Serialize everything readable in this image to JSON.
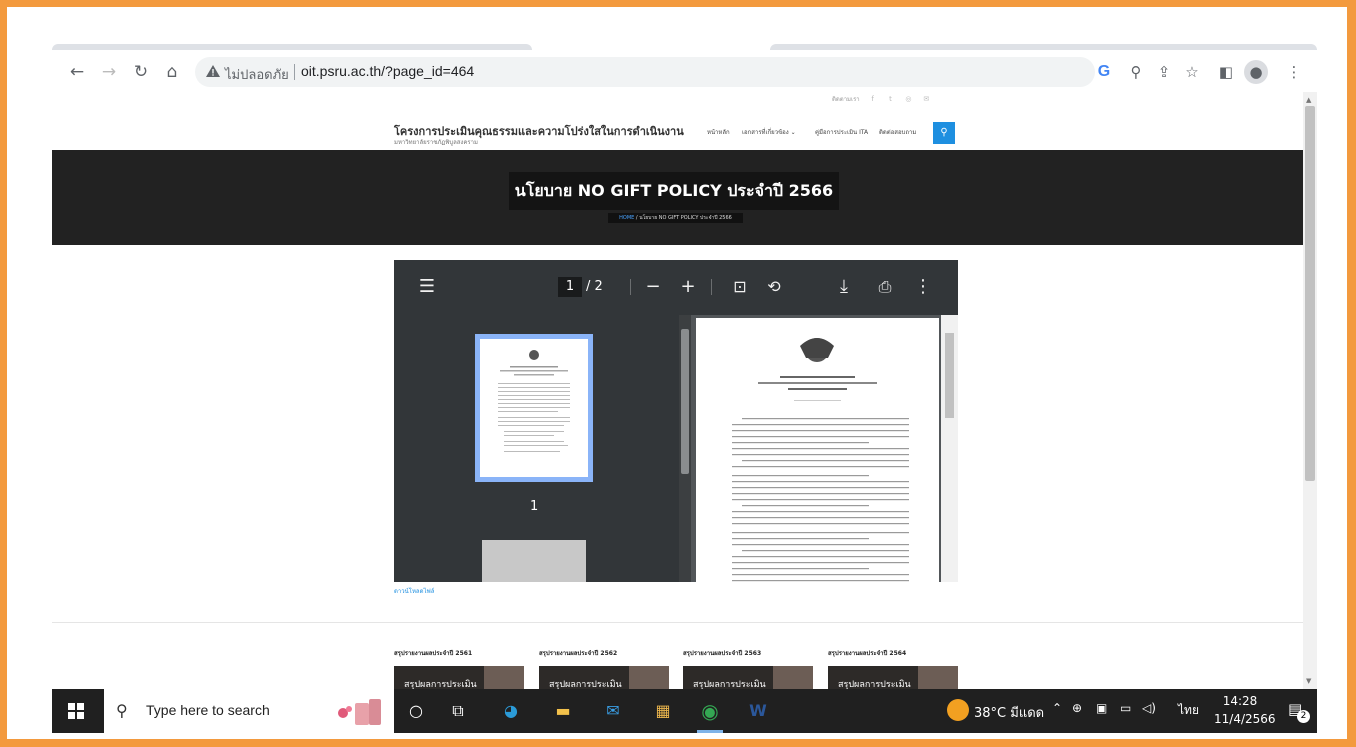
{
  "browser": {
    "security_label": "ไม่ปลอดภัย",
    "url": "oit.psru.ac.th/?page_id=464"
  },
  "site": {
    "top_text": "ติดตามเรา",
    "title": "โครงการประเมินคุณธรรมและความโปร่งใสในการดำเนินงาน",
    "subtitle": "มหาวิทยาลัยราชภัฏพิบูลสงคราม",
    "menu": [
      "หน้าหลัก",
      "เอกสารที่เกี่ยวข้อง ⌄",
      "คู่มือการประเมิน ITA",
      "ติดต่อสอบถาม"
    ]
  },
  "hero": {
    "title": "นโยบาย NO GIFT POLICY ประจำปี 2566",
    "breadcrumb_home": "HOME",
    "breadcrumb_current": " / นโยบาย NO GIFT POLICY ประจำปี 2566"
  },
  "pdf": {
    "current_page": "1",
    "total_pages": "/ 2",
    "thumb_number": "1"
  },
  "download_link": "ดาวน์โหลดไฟล์",
  "cards": [
    {
      "title": "สรุปรายงานผลประจำปี 2561",
      "label": "สรุปผลการประเมิน"
    },
    {
      "title": "สรุปรายงานผลประจำปี 2562",
      "label": "สรุปผลการประเมิน"
    },
    {
      "title": "สรุปรายงานผลประจำปี 2563",
      "label": "สรุปผลการประเมิน"
    },
    {
      "title": "สรุปรายงานผลประจำปี 2564",
      "label": "สรุปผลการประเมิน"
    }
  ],
  "taskbar": {
    "search_placeholder": "Type here to search",
    "weather": "38°C มีแดด",
    "lang": "ไทย",
    "time": "14:28",
    "date": "11/4/2566",
    "notif_count": "2"
  }
}
